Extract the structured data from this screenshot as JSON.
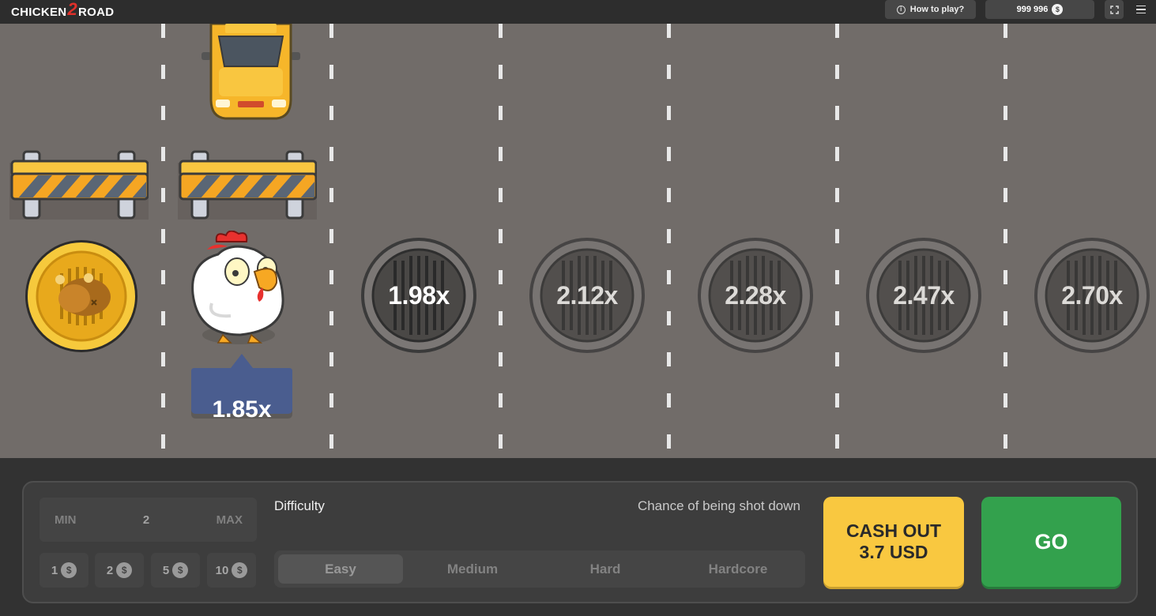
{
  "header": {
    "logo_left": "CHICKEN",
    "logo_mid": "2",
    "logo_right": "ROAD",
    "how_to_play": "How to play?",
    "balance": "999 996",
    "currency_icon": "dollar-coin-icon",
    "fullscreen_icon": "fullscreen-icon",
    "menu_icon": "hamburger-menu-icon"
  },
  "game": {
    "current_multiplier": "1.85x",
    "next_multipliers": [
      "1.98x",
      "2.12x",
      "2.28x",
      "2.47x",
      "2.70x"
    ],
    "collected_icon": "roast-chicken-coin-icon",
    "player_icon": "chicken-icon",
    "obstacle_icon": "car-icon",
    "barrier_icon": "road-barrier-icon",
    "colors": {
      "road": "#716c69",
      "tag": "#4a5d8f",
      "gold": "#f5c93b"
    }
  },
  "controls": {
    "bet": {
      "min_label": "MIN",
      "value": "2",
      "max_label": "MAX"
    },
    "quick_bets": [
      "1",
      "2",
      "5",
      "10"
    ],
    "quick_bet_coin": "$",
    "difficulty_label": "Difficulty",
    "chance_label": "Chance of being shot down",
    "difficulties": [
      "Easy",
      "Medium",
      "Hard",
      "Hardcore"
    ],
    "active_difficulty": "Easy",
    "cashout_line1": "CASH OUT",
    "cashout_line2": "3.7 USD",
    "go_label": "GO",
    "colors": {
      "cashout": "#f9c840",
      "go": "#33a14d"
    }
  }
}
